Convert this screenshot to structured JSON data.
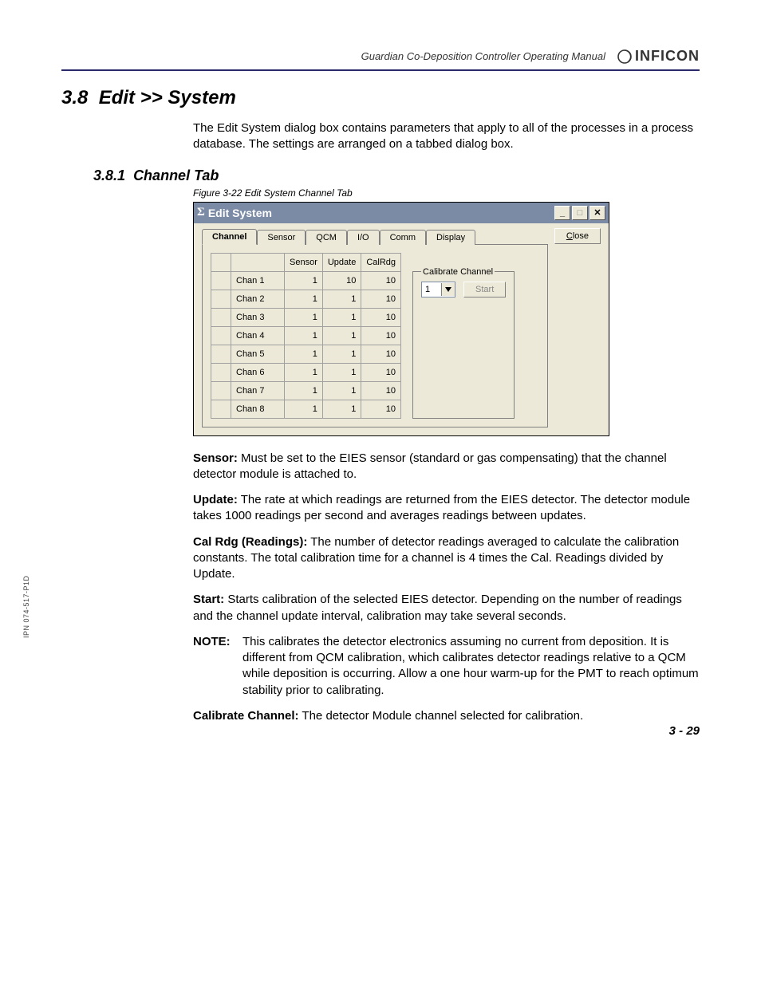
{
  "header": {
    "manual_title": "Guardian Co-Deposition Controller Operating Manual",
    "brand": "INFICON"
  },
  "section": {
    "number": "3.8",
    "title": "Edit >> System",
    "intro": "The Edit System dialog box contains parameters that apply to all of the processes in a process database. The settings are arranged on a tabbed dialog box."
  },
  "subsection": {
    "number": "3.8.1",
    "title": "Channel Tab",
    "figure_caption": "Figure 3-22  Edit System Channel Tab"
  },
  "dialog": {
    "sigma": "Σ",
    "title": "Edit System",
    "tabs": [
      "Channel",
      "Sensor",
      "QCM",
      "I/O",
      "Comm",
      "Display"
    ],
    "close_label": "Close",
    "table": {
      "cols": [
        "Sensor",
        "Update",
        "CalRdg"
      ],
      "rows": [
        {
          "label": "Chan 1",
          "sensor": "1",
          "update": "10",
          "calrdg": "10"
        },
        {
          "label": "Chan 2",
          "sensor": "1",
          "update": "1",
          "calrdg": "10"
        },
        {
          "label": "Chan 3",
          "sensor": "1",
          "update": "1",
          "calrdg": "10"
        },
        {
          "label": "Chan 4",
          "sensor": "1",
          "update": "1",
          "calrdg": "10"
        },
        {
          "label": "Chan 5",
          "sensor": "1",
          "update": "1",
          "calrdg": "10"
        },
        {
          "label": "Chan 6",
          "sensor": "1",
          "update": "1",
          "calrdg": "10"
        },
        {
          "label": "Chan 7",
          "sensor": "1",
          "update": "1",
          "calrdg": "10"
        },
        {
          "label": "Chan 8",
          "sensor": "1",
          "update": "1",
          "calrdg": "10"
        }
      ]
    },
    "calibrate": {
      "legend": "Calibrate Channel",
      "selected": "1",
      "start_label": "Start"
    }
  },
  "descriptions": {
    "sensor_b": "Sensor:",
    "sensor_t": " Must be set to the EIES sensor (standard or gas compensating) that the channel detector module is attached to.",
    "update_b": "Update:",
    "update_t": " The rate at which readings are returned from the EIES detector. The detector module takes 1000 readings per second and averages readings between updates.",
    "calrdg_b": "Cal Rdg (Readings):",
    "calrdg_t": " The number of detector readings averaged to calculate the calibration constants. The total calibration time for a channel is 4 times the Cal. Readings divided by Update.",
    "start_b": "Start:",
    "start_t": " Starts calibration of the selected EIES detector. Depending on the number of readings and the channel update interval, calibration may take several seconds.",
    "note_label": "NOTE:",
    "note_t": "This calibrates the detector electronics assuming no current from deposition. It is different from QCM calibration, which calibrates detector readings relative to a QCM while deposition is occurring. Allow a one hour warm-up for the PMT to reach optimum stability prior to calibrating.",
    "calch_b": "Calibrate Channel:",
    "calch_t": " The detector Module channel selected for calibration."
  },
  "side_note": "IPN 074-517-P1D",
  "page_number": "3 - 29"
}
